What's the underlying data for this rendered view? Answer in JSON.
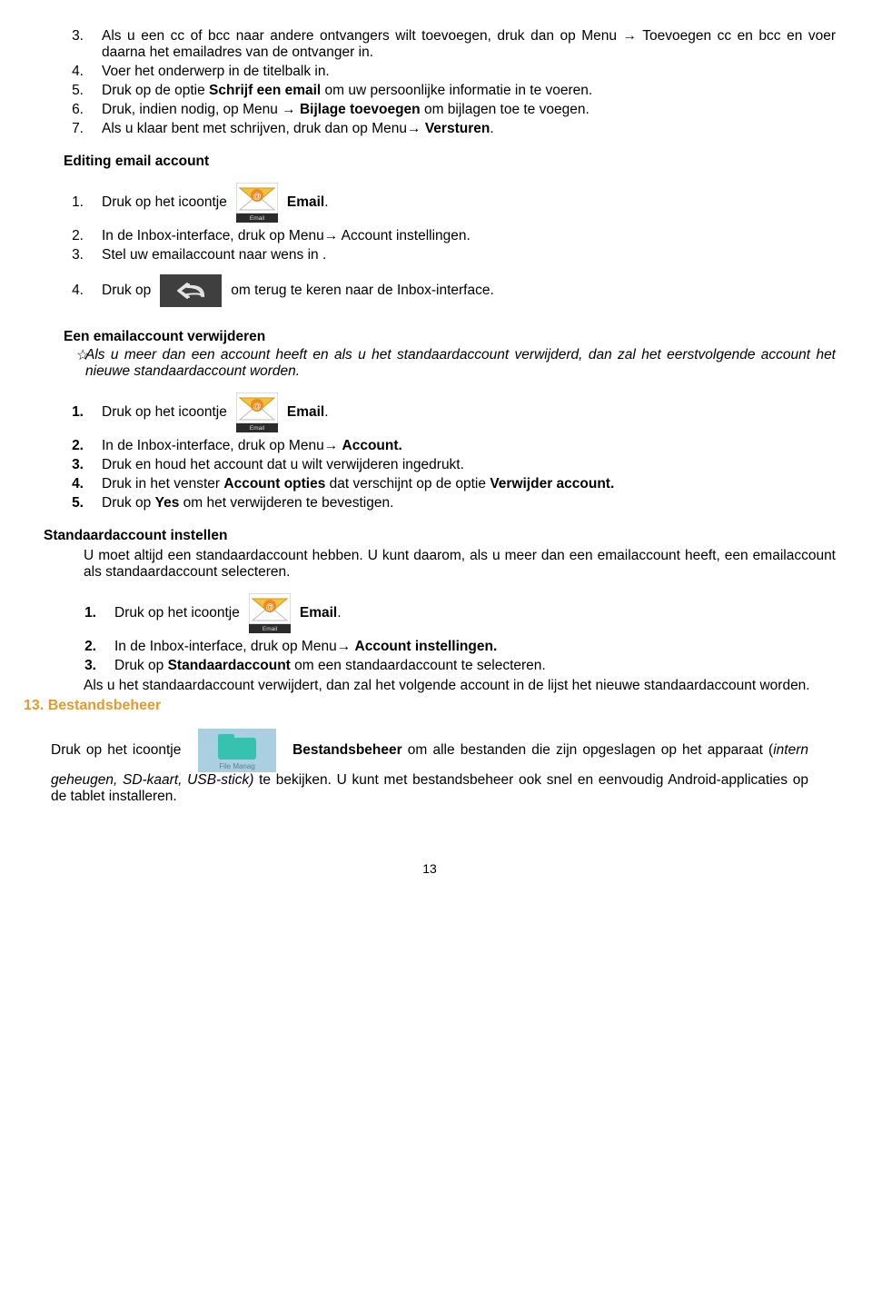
{
  "list1": [
    {
      "n": "3.",
      "pre": "Als u een cc of bcc naar andere ontvangers wilt toevoegen, druk dan op Menu →  Toevoegen cc en bcc en voer daarna het emailadres van de ontvanger in."
    },
    {
      "n": "4.",
      "pre": "Voer het onderwerp in de titelbalk in."
    },
    {
      "n": "5.",
      "pre": "Druk op de optie ",
      "bold1": "Schrijf een email",
      "post": " om uw persoonlijke informatie in te voeren."
    },
    {
      "n": "6.",
      "pre": "Druk, indien nodig, op Menu → ",
      "bold1": "Bijlage toevoegen",
      "post": " om bijlagen toe te voegen."
    },
    {
      "n": "7.",
      "pre": "Als u klaar bent met schrijven, druk dan op Menu→ ",
      "bold1": "Versturen",
      "post": "."
    }
  ],
  "editing_head": "Editing email account",
  "edit": {
    "r1": {
      "n": "1.",
      "before": "Druk op het icoontje",
      "after_bold": "Email",
      "after": "."
    },
    "r2": {
      "n": "2.",
      "text": "In de Inbox-interface, druk op Menu→ Account instellingen."
    },
    "r3": {
      "n": "3.",
      "text": "Stel uw emailaccount naar wens in ."
    },
    "r4": {
      "n": "4.",
      "before": "Druk op",
      "after": "om terug te keren naar de Inbox-interface."
    }
  },
  "remove_head": "Een emailaccount verwijderen",
  "remove_star": "Als u meer dan een account heeft en als u het standaardaccount verwijderd, dan zal het eerstvolgende account het nieuwe standaardaccount worden.",
  "remove": {
    "r1": {
      "n": "1.",
      "before": "Druk op het icoontje",
      "after_bold": "Email",
      "after": "."
    },
    "r2": {
      "n": "2.",
      "pre": "In de Inbox-interface, druk op Menu→ ",
      "bold1": "Account."
    },
    "r3": {
      "n": "3.",
      "pre": "Druk en houd het account dat u wilt verwijderen ingedrukt."
    },
    "r4": {
      "n": "4.",
      "pre": "Druk in het venster ",
      "bold1": "Account opties",
      "mid": " dat verschijnt op de optie ",
      "bold2": "Verwijder account."
    },
    "r5": {
      "n": "5.",
      "pre": "Druk op ",
      "bold1": "Yes",
      "post": " om het verwijderen te bevestigen."
    }
  },
  "default_head": "Standaardaccount instellen",
  "default_para": "U moet altijd een standaardaccount hebben. U kunt daarom, als u meer dan een emailaccount heeft, een emailaccount als standaardaccount selecteren.",
  "default": {
    "r1": {
      "n": "1.",
      "before": "Druk op het icoontje",
      "after_bold": "Email",
      "after": "."
    },
    "r2": {
      "n": "2.",
      "pre": "In de Inbox-interface, druk op Menu→ ",
      "bold1": "Account instellingen."
    },
    "r3": {
      "n": "3.",
      "pre": "Druk op ",
      "bold1": "Standaardaccount",
      "post": " om een standaardaccount te selecteren."
    }
  },
  "default_note": "Als u het standaardaccount verwijdert, dan zal het volgende account in de lijst het nieuwe standaardaccount worden.",
  "chapter": "13. Bestandsbeheer",
  "files": {
    "before": "Druk op het icoontje",
    "icon_label": "File Manag",
    "bold": "Bestandsbeheer",
    "mid": " om alle bestanden die zijn opgeslagen op het apparaat (",
    "italic": "intern geheugen, SD-kaart, USB-stick)",
    "post": " te bekijken. U kunt met bestandsbeheer ook snel en eenvoudig Android-applicaties op de tablet installeren."
  },
  "page_number": "13"
}
